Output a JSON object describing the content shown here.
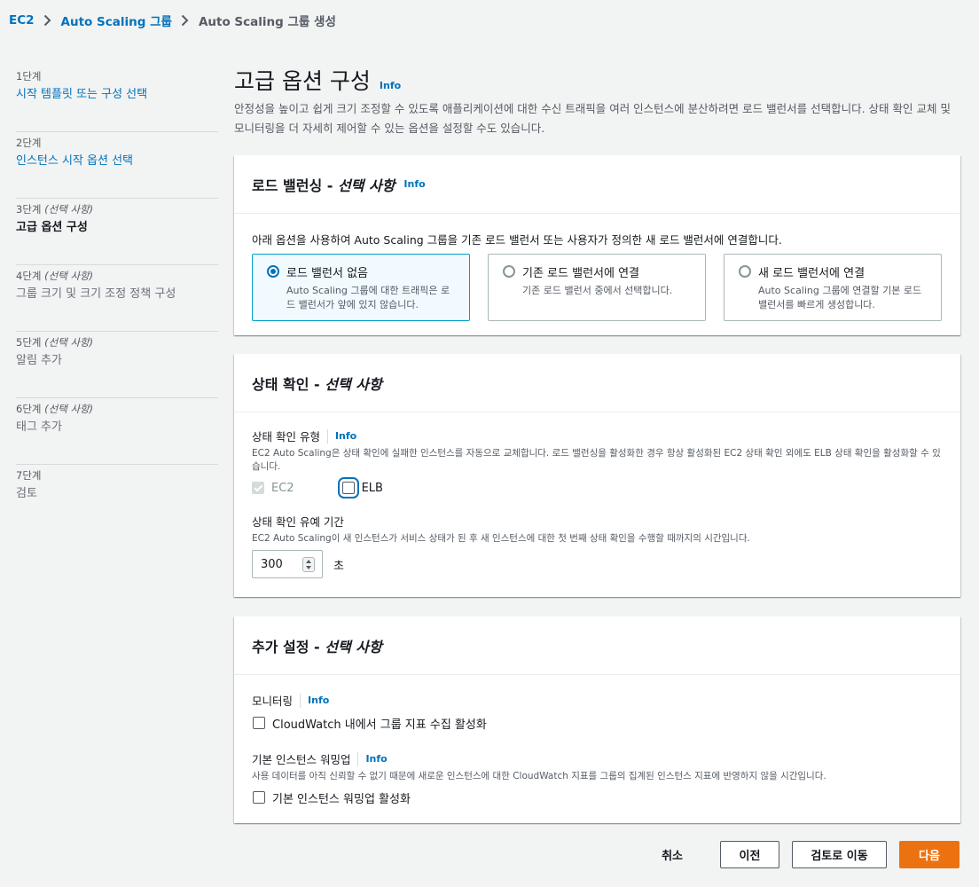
{
  "breadcrumb": {
    "items": [
      "EC2",
      "Auto Scaling 그룹",
      "Auto Scaling 그룹 생성"
    ]
  },
  "steps": [
    {
      "num": "1단계",
      "optional": "",
      "label": "시작 템플릿 또는 구성 선택",
      "state": "link"
    },
    {
      "num": "2단계",
      "optional": "",
      "label": "인스턴스 시작 옵션 선택",
      "state": "link"
    },
    {
      "num": "3단계",
      "optional": "(선택 사항)",
      "label": "고급 옵션 구성",
      "state": "active"
    },
    {
      "num": "4단계",
      "optional": "(선택 사항)",
      "label": "그룹 크기 및 크기 조정 정책 구성",
      "state": "disabled"
    },
    {
      "num": "5단계",
      "optional": "(선택 사항)",
      "label": "알림 추가",
      "state": "disabled"
    },
    {
      "num": "6단계",
      "optional": "(선택 사항)",
      "label": "태그 추가",
      "state": "disabled"
    },
    {
      "num": "7단계",
      "optional": "",
      "label": "검토",
      "state": "disabled"
    }
  ],
  "page": {
    "title": "고급 옵션 구성",
    "info": "Info",
    "description": "안정성을 높이고 쉽게 크기 조정할 수 있도록 애플리케이션에 대한 수신 트래픽을 여러 인스턴스에 분산하려면 로드 밸런서를 선택합니다. 상태 확인 교체 및 모니터링을 더 자세히 제어할 수 있는 옵션을 설정할 수도 있습니다."
  },
  "load_balancing": {
    "title": "로드 밸런싱 - ",
    "title_optional": "선택 사항",
    "info": "Info",
    "description": "아래 옵션을 사용하여 Auto Scaling 그룹을 기존 로드 밸런서 또는 사용자가 정의한 새 로드 밸런서에 연결합니다.",
    "options": [
      {
        "title": "로드 밸런서 없음",
        "desc": "Auto Scaling 그룹에 대한 트래픽은 로드 밸런서가 앞에 있지 않습니다.",
        "selected": true
      },
      {
        "title": "기존 로드 밸런서에 연결",
        "desc": "기존 로드 밸런서 중에서 선택합니다.",
        "selected": false
      },
      {
        "title": "새 로드 밸런서에 연결",
        "desc": "Auto Scaling 그룹에 연결할 기본 로드 밸런서를 빠르게 생성합니다.",
        "selected": false
      }
    ]
  },
  "health_check": {
    "title": "상태 확인 - ",
    "title_optional": "선택 사항",
    "type_label": "상태 확인 유형",
    "type_info": "Info",
    "type_desc": "EC2 Auto Scaling은 상태 확인에 실패한 인스턴스를 자동으로 교체합니다. 로드 밸런싱을 활성화한 경우 항상 활성화된 EC2 상태 확인 외에도 ELB 상태 확인을 활성화할 수 있습니다.",
    "ec2_label": "EC2",
    "elb_label": "ELB",
    "grace_label": "상태 확인 유예 기간",
    "grace_desc": "EC2 Auto Scaling이 새 인스턴스가 서비스 상태가 된 후 새 인스턴스에 대한 첫 번째 상태 확인을 수행할 때까지의 시간입니다.",
    "grace_value": "300",
    "grace_unit": "초"
  },
  "additional": {
    "title": "추가 설정 - ",
    "title_optional": "선택 사항",
    "monitoring_label": "모니터링",
    "monitoring_info": "Info",
    "monitoring_checkbox": "CloudWatch 내에서 그룹 지표 수집 활성화",
    "warmup_label": "기본 인스턴스 워밍업",
    "warmup_info": "Info",
    "warmup_desc": "사용 데이터를 아직 신뢰할 수 없기 때문에 새로운 인스턴스에 대한 CloudWatch 지표를 그룹의 집계된 인스턴스 지표에 반영하지 않을 시간입니다.",
    "warmup_checkbox": "기본 인스턴스 워밍업 활성화"
  },
  "footer": {
    "cancel": "취소",
    "previous": "이전",
    "skip_to_review": "검토로 이동",
    "next": "다음"
  },
  "colors": {
    "link": "#0073bb",
    "primary": "#ec7211",
    "selected_border": "#00a1c9",
    "selected_bg": "#f1faff"
  }
}
